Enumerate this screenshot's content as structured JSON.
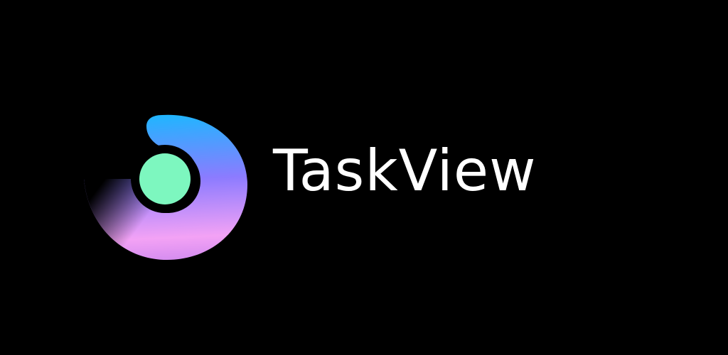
{
  "brand": {
    "name": "TaskView",
    "logo_icon": "taskview-logo-icon",
    "colors": {
      "background": "#000000",
      "text": "#ffffff",
      "dot": "#7df7bf",
      "gradient_blue": "#1fb6ff",
      "gradient_violet": "#8c7bff",
      "gradient_pink": "#f3a2f5"
    }
  }
}
